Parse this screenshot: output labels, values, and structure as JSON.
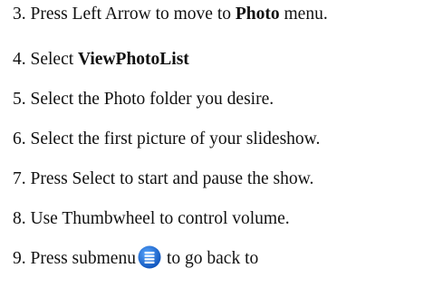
{
  "steps": [
    {
      "num": "3.",
      "pre": "Press Left Arrow to move to ",
      "bold": "Photo",
      "post": " menu."
    },
    {
      "num": "4.",
      "pre": "Select ",
      "bold": "ViewPhotoList",
      "post": ""
    },
    {
      "num": "5.",
      "text": "Select the Photo folder you desire."
    },
    {
      "num": "6.",
      "text": "Select the first picture of your slideshow."
    },
    {
      "num": "7.",
      "text": "Press Select to start and pause the show."
    },
    {
      "num": "8.",
      "text": "Use Thumbwheel to control volume."
    },
    {
      "num": "9.",
      "pre": "Press submenu",
      "post": "to go back to"
    }
  ],
  "icons": {
    "submenu": "submenu-icon",
    "submenu_color": "#1f6fd6"
  }
}
